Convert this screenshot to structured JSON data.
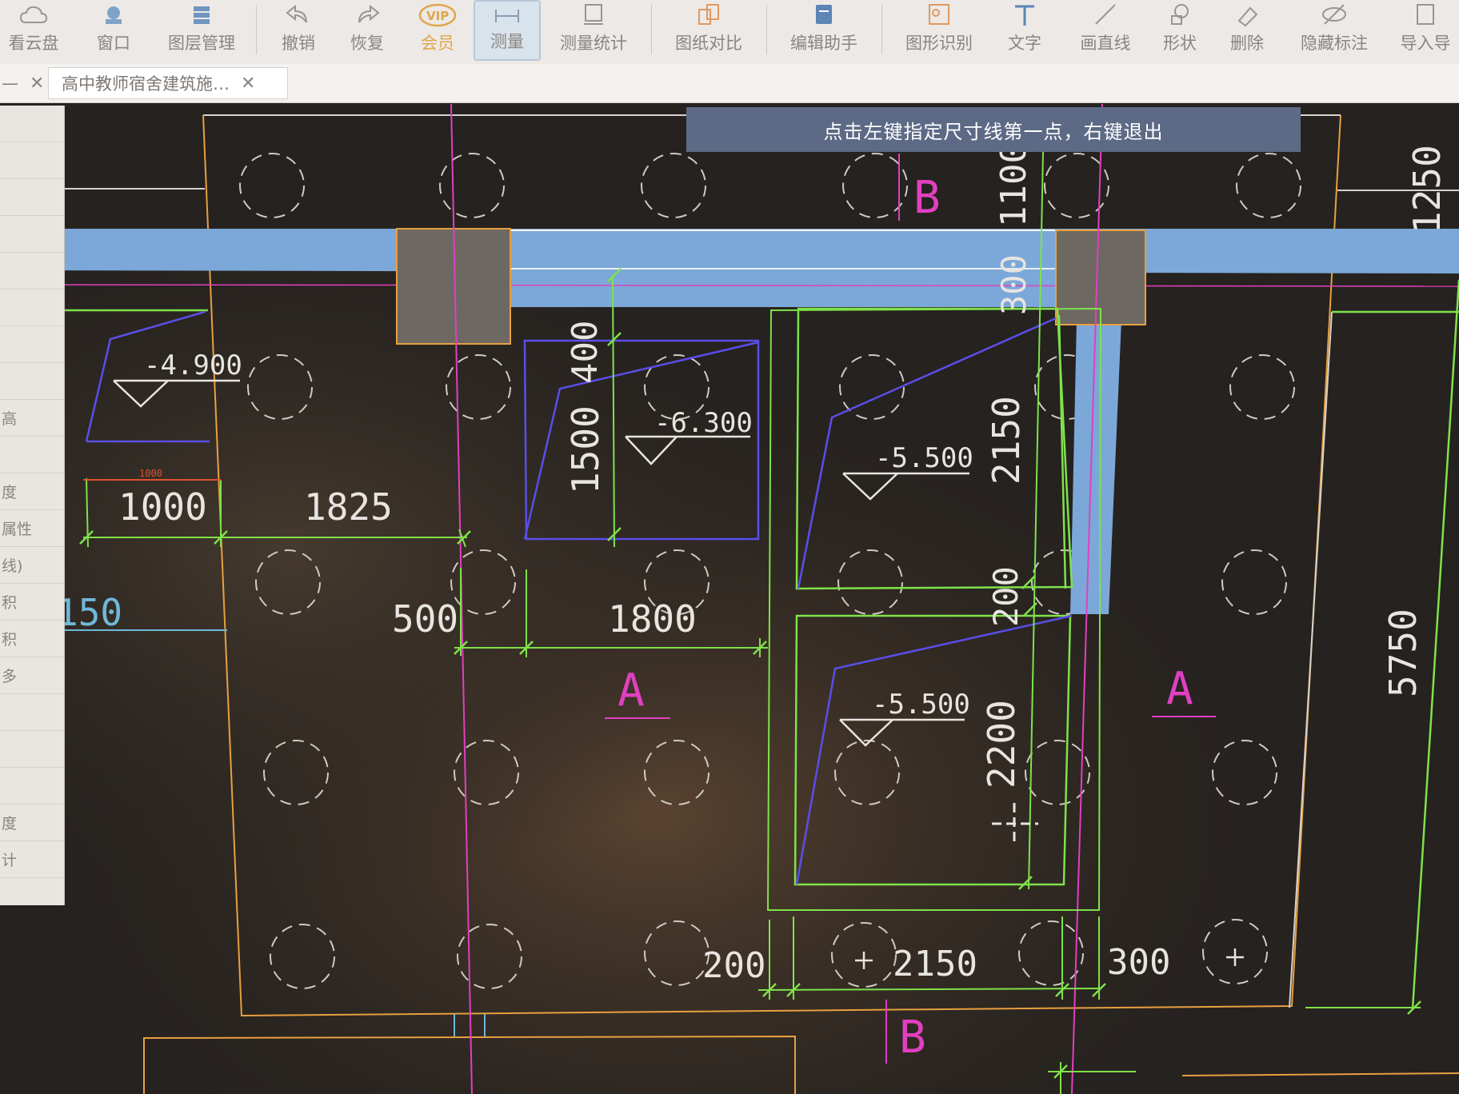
{
  "toolbar": {
    "items": [
      {
        "label": "看云盘",
        "icon": "cloud-icon"
      },
      {
        "label": "窗口",
        "icon": "window-icon"
      },
      {
        "label": "图层管理",
        "icon": "layers-icon"
      },
      {
        "label": "撤销",
        "icon": "undo-icon"
      },
      {
        "label": "恢复",
        "icon": "redo-icon"
      },
      {
        "label": "会员",
        "icon": "vip-icon"
      },
      {
        "label": "测量",
        "icon": "measure-icon"
      },
      {
        "label": "测量统计",
        "icon": "measure-stats-icon"
      },
      {
        "label": "图纸对比",
        "icon": "compare-icon"
      },
      {
        "label": "编辑助手",
        "icon": "edit-assistant-icon"
      },
      {
        "label": "图形识别",
        "icon": "shape-recognition-icon"
      },
      {
        "label": "文字",
        "icon": "text-icon"
      },
      {
        "label": "画直线",
        "icon": "line-icon"
      },
      {
        "label": "形状",
        "icon": "shape-icon"
      },
      {
        "label": "删除",
        "icon": "eraser-icon"
      },
      {
        "label": "隐藏标注",
        "icon": "hide-annotation-icon"
      },
      {
        "label": "导入导",
        "icon": "import-icon"
      }
    ],
    "vip_badge": "VIP"
  },
  "tabs": [
    {
      "label": "高中教师宿舍建筑施…"
    }
  ],
  "left_panel": {
    "items": [
      "高",
      "度",
      "属性",
      "线)",
      "积",
      "积",
      "多",
      "度",
      "计"
    ]
  },
  "hint": "点击左键指定尺寸线第一点，右键退出",
  "drawing": {
    "axis_labels": {
      "b_top": "B",
      "b_bottom": "B",
      "a_left": "A",
      "a_right": "A"
    },
    "elevations": {
      "e1": "-4.900",
      "e2": "-6.300",
      "e3": "-5.500",
      "e4": "-5.500"
    },
    "dimensions": {
      "d1000": "1000",
      "d1000_small": "1000",
      "d1825": "1825",
      "d150": "150",
      "d500": "500",
      "d1800": "1800",
      "d400": "400",
      "d1500": "1500",
      "d1100": "1100",
      "d300_v": "300",
      "d2150_v": "2150",
      "d200_v": "200",
      "d2200": "2200",
      "d200_h": "200",
      "d2150_h": "2150",
      "d300_h": "300",
      "d1250": "1250",
      "d5750": "5750"
    }
  },
  "colors": {
    "background": "#2b2622",
    "dim_green": "#7fe24a",
    "pink_axis": "#e040c0",
    "orange": "#e8a040",
    "blue_beam": "#7ba8d8",
    "violet": "#5a4ee8",
    "column": "#6e6862"
  }
}
